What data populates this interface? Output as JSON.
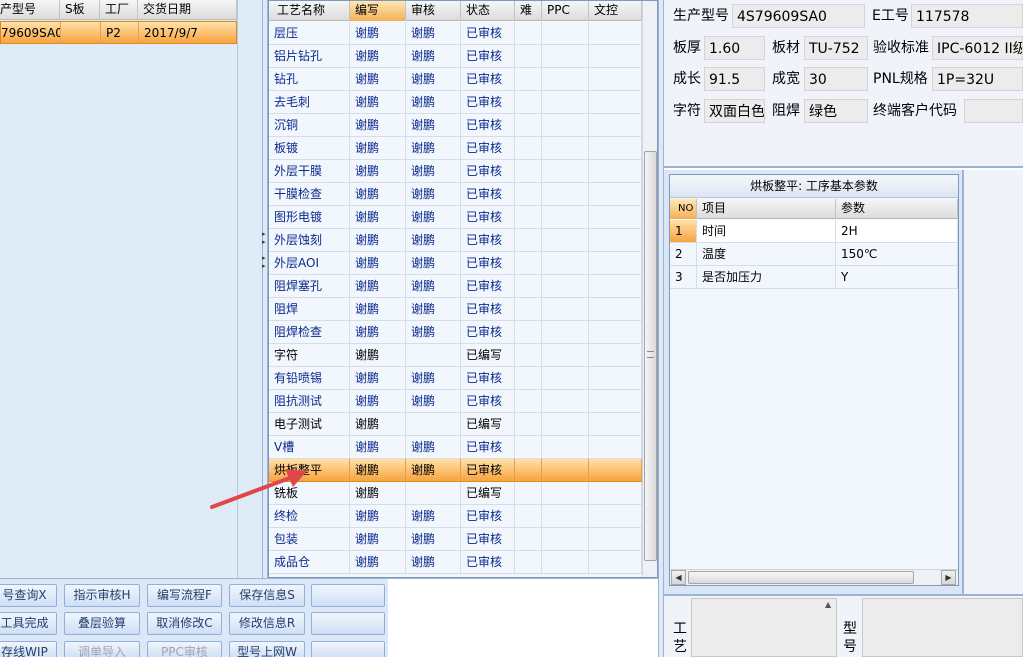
{
  "left_grid": {
    "headers": [
      "产型号",
      "S板",
      "工厂",
      "交货日期"
    ],
    "rows": [
      {
        "model": "79609SA0",
        "s_board": "",
        "factory": "P2",
        "date": "2017/9/7"
      }
    ]
  },
  "process_grid": {
    "headers": [
      "工艺名称",
      "编写",
      "审核",
      "状态",
      "难",
      "PPC",
      "文控"
    ],
    "rows": [
      {
        "name": "层压",
        "writer": "谢鹏",
        "reviewer": "谢鹏",
        "status": "已审核"
      },
      {
        "name": "铝片钻孔",
        "writer": "谢鹏",
        "reviewer": "谢鹏",
        "status": "已审核"
      },
      {
        "name": "钻孔",
        "writer": "谢鹏",
        "reviewer": "谢鹏",
        "status": "已审核"
      },
      {
        "name": "去毛刺",
        "writer": "谢鹏",
        "reviewer": "谢鹏",
        "status": "已审核"
      },
      {
        "name": "沉铜",
        "writer": "谢鹏",
        "reviewer": "谢鹏",
        "status": "已审核"
      },
      {
        "name": "板镀",
        "writer": "谢鹏",
        "reviewer": "谢鹏",
        "status": "已审核"
      },
      {
        "name": "外层干膜",
        "writer": "谢鹏",
        "reviewer": "谢鹏",
        "status": "已审核"
      },
      {
        "name": "干膜检查",
        "writer": "谢鹏",
        "reviewer": "谢鹏",
        "status": "已审核"
      },
      {
        "name": "图形电镀",
        "writer": "谢鹏",
        "reviewer": "谢鹏",
        "status": "已审核"
      },
      {
        "name": "外层蚀刻",
        "writer": "谢鹏",
        "reviewer": "谢鹏",
        "status": "已审核"
      },
      {
        "name": "外层AOI",
        "writer": "谢鹏",
        "reviewer": "谢鹏",
        "status": "已审核"
      },
      {
        "name": "阻焊塞孔",
        "writer": "谢鹏",
        "reviewer": "谢鹏",
        "status": "已审核"
      },
      {
        "name": "阻焊",
        "writer": "谢鹏",
        "reviewer": "谢鹏",
        "status": "已审核"
      },
      {
        "name": "阻焊检查",
        "writer": "谢鹏",
        "reviewer": "谢鹏",
        "status": "已审核"
      },
      {
        "name": "字符",
        "writer": "谢鹏",
        "reviewer": "",
        "status": "已编写"
      },
      {
        "name": "有铅喷锡",
        "writer": "谢鹏",
        "reviewer": "谢鹏",
        "status": "已审核"
      },
      {
        "name": "阻抗测试",
        "writer": "谢鹏",
        "reviewer": "谢鹏",
        "status": "已审核"
      },
      {
        "name": "电子测试",
        "writer": "谢鹏",
        "reviewer": "",
        "status": "已编写"
      },
      {
        "name": "V槽",
        "writer": "谢鹏",
        "reviewer": "谢鹏",
        "status": "已审核"
      },
      {
        "name": "烘板整平",
        "writer": "谢鹏",
        "reviewer": "谢鹏",
        "status": "已审核"
      },
      {
        "name": "铣板",
        "writer": "谢鹏",
        "reviewer": "",
        "status": "已编写"
      },
      {
        "name": "终检",
        "writer": "谢鹏",
        "reviewer": "谢鹏",
        "status": "已审核"
      },
      {
        "name": "包装",
        "writer": "谢鹏",
        "reviewer": "谢鹏",
        "status": "已审核"
      },
      {
        "name": "成品仓",
        "writer": "谢鹏",
        "reviewer": "谢鹏",
        "status": "已审核"
      }
    ],
    "selected_index": 19
  },
  "info": {
    "model_label": "生产型号",
    "model_value": "4S79609SA0",
    "eno_label": "E工号",
    "eno_value": "117578",
    "thickness_label": "板厚",
    "thickness_value": "1.60",
    "material_label": "板材",
    "material_value": "TU-752",
    "standard_label": "验收标准",
    "standard_value": "IPC-6012 II级",
    "length_label": "成长",
    "length_value": "91.5",
    "width_label": "成宽",
    "width_value": "30",
    "pnl_label": "PNL规格",
    "pnl_value": "1P=32U",
    "silk_label": "字符",
    "silk_value": "双面白色",
    "mask_label": "阻焊",
    "mask_value": "绿色",
    "customer_label": "终端客户代码",
    "customer_value": ""
  },
  "params": {
    "title": "烘板整平: 工序基本参数",
    "headers": [
      "NO",
      "项目",
      "参数"
    ],
    "rows": [
      {
        "no": "1",
        "item": "时间",
        "value": "2H"
      },
      {
        "no": "2",
        "item": "温度",
        "value": "150℃"
      },
      {
        "no": "3",
        "item": "是否加压力",
        "value": "Y"
      }
    ]
  },
  "bottom_labels": {
    "craft": "工艺",
    "model": "型号"
  },
  "buttons": [
    [
      "号查询X",
      "指示审核H",
      "编写流程F",
      "保存信息S",
      ""
    ],
    [
      "工具完成",
      "叠层验算",
      "取消修改C",
      "修改信息R",
      ""
    ],
    [
      "存线WIP",
      "调单导入",
      "PPC审核",
      "型号上网W",
      ""
    ]
  ],
  "colors": {
    "selection": "#f7a440",
    "arrow": "#e0474c",
    "grid_bg": "#f2f6fd",
    "panel_bg": "#dae6f5"
  }
}
